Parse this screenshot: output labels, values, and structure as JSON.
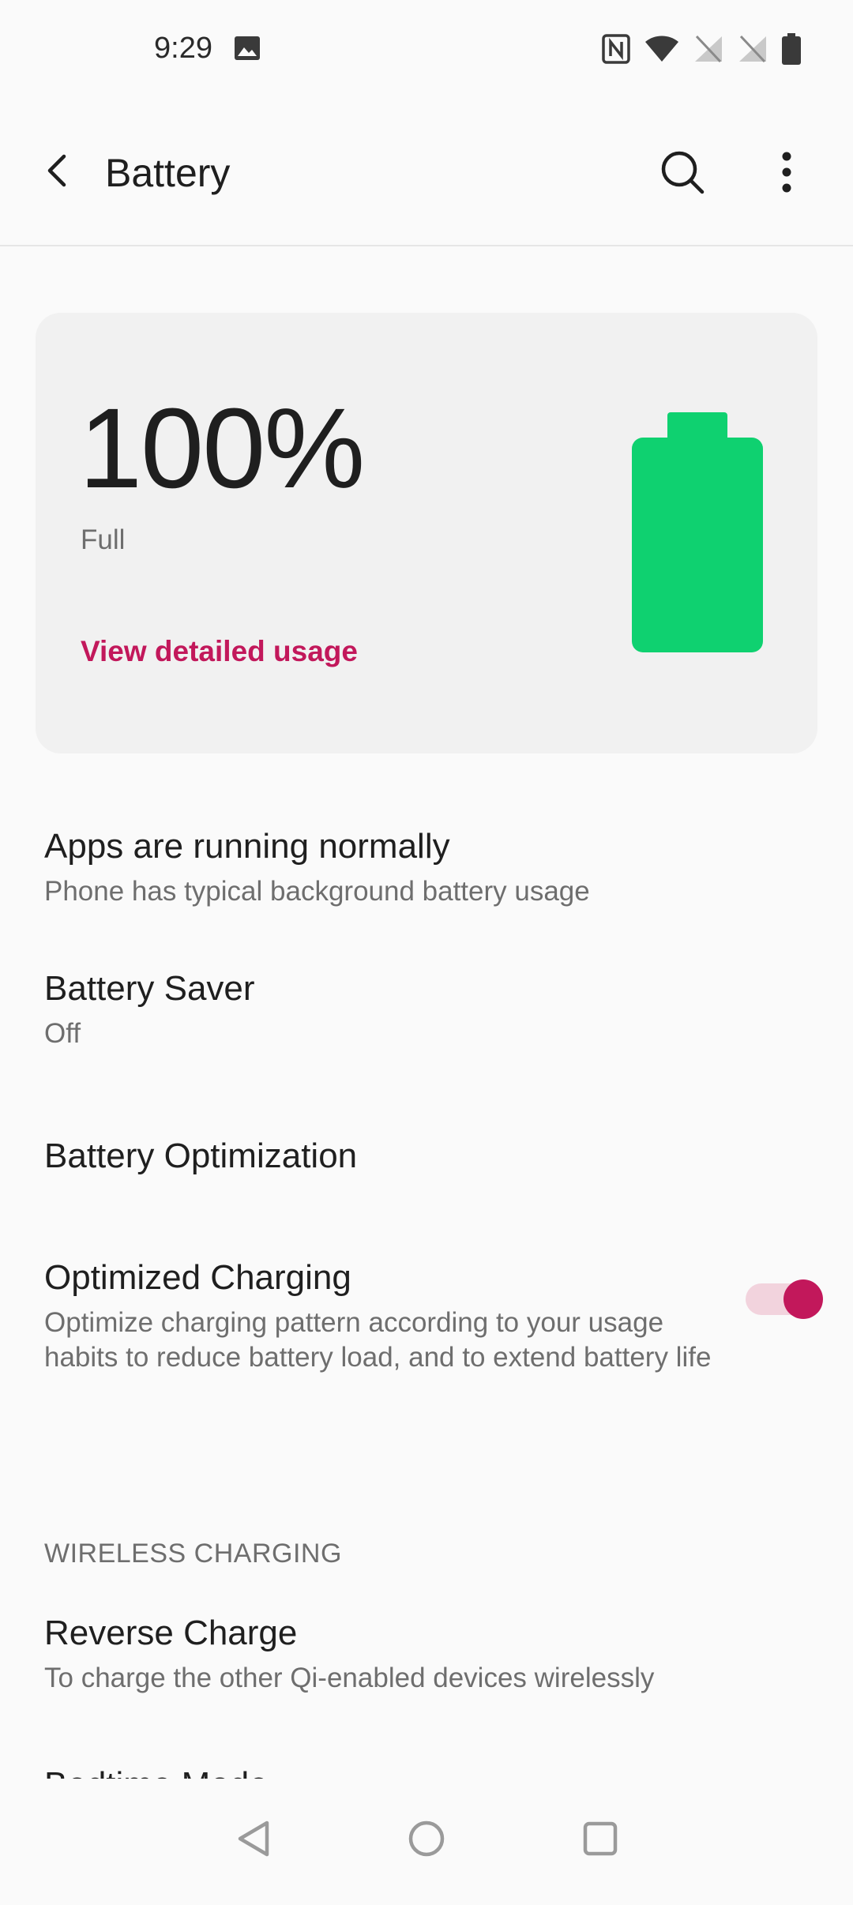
{
  "status_bar": {
    "time": "9:29",
    "left_icons": [
      "image-icon"
    ],
    "right_icons": [
      "nfc-icon",
      "wifi-icon",
      "no-signal-icon",
      "no-signal-icon",
      "battery-icon"
    ]
  },
  "app_bar": {
    "title": "Battery",
    "icons": [
      "back-arrow-icon",
      "search-icon",
      "more-vert-icon"
    ]
  },
  "battery_card": {
    "percent_text": "100%",
    "level": 1.0,
    "status": "Full",
    "link_label": "View detailed usage",
    "battery_color": "#0fd170",
    "link_color": "#c2185b"
  },
  "items": [
    {
      "title": "Apps are running normally",
      "summary": "Phone has typical background battery usage"
    },
    {
      "title": "Battery Saver",
      "summary": "Off"
    },
    {
      "title": "Battery Optimization",
      "summary": ""
    },
    {
      "title": "Optimized Charging",
      "summary": "Optimize charging pattern according to your usage habits to reduce battery load, and to extend battery life",
      "toggle_on": true
    }
  ],
  "wireless_section": {
    "header": "WIRELESS CHARGING",
    "items": [
      {
        "title": "Reverse Charge",
        "summary": "To charge the other Qi-enabled devices wirelessly"
      },
      {
        "title": "Bedtime Mode"
      }
    ]
  },
  "toggle_colors": {
    "track": "#f2d3dd",
    "thumb": "#c2185b"
  },
  "nav_bar": {
    "icons": [
      "nav-back-icon",
      "nav-home-icon",
      "nav-recents-icon"
    ]
  }
}
